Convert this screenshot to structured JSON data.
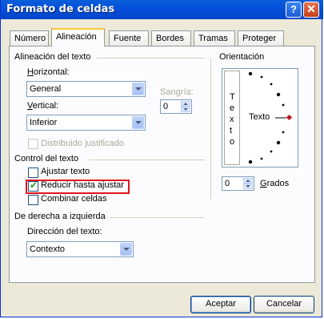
{
  "window": {
    "title": "Formato de celdas",
    "help_label": "?",
    "close_label": "✕"
  },
  "tabs": [
    {
      "label": "Número",
      "active": false
    },
    {
      "label": "Alineación",
      "active": true
    },
    {
      "label": "Fuente",
      "active": false
    },
    {
      "label": "Bordes",
      "active": false
    },
    {
      "label": "Tramas",
      "active": false
    },
    {
      "label": "Proteger",
      "active": false
    }
  ],
  "alignment": {
    "section_label": "Alineación del texto",
    "horizontal_label": "Horizontal:",
    "horizontal_value": "General",
    "vertical_label": "Vertical:",
    "vertical_value": "Inferior",
    "indent_label": "Sangría:",
    "indent_value": "0",
    "distributed_label": "Distribuido justificado",
    "distributed_checked": false
  },
  "text_control": {
    "section_label": "Control del texto",
    "wrap_label": "Ajustar texto",
    "wrap_checked": false,
    "shrink_label": "Reducir hasta ajustar",
    "shrink_checked": true,
    "merge_label": "Combinar celdas",
    "merge_checked": false
  },
  "rtl": {
    "section_label": "De derecha a izquierda",
    "direction_label": "Dirección del texto:",
    "direction_value": "Contexto"
  },
  "orientation": {
    "section_label": "Orientación",
    "vertical_text": [
      "T",
      "e",
      "x",
      "t",
      "o"
    ],
    "dial_text": "Texto",
    "degrees_value": "0",
    "degrees_label": "Grados"
  },
  "buttons": {
    "ok_label": "Aceptar",
    "cancel_label": "Cancelar"
  },
  "colors": {
    "titlebar": "#0550dc",
    "highlight": "#e0141e",
    "dial_marker": "#c0141e"
  }
}
